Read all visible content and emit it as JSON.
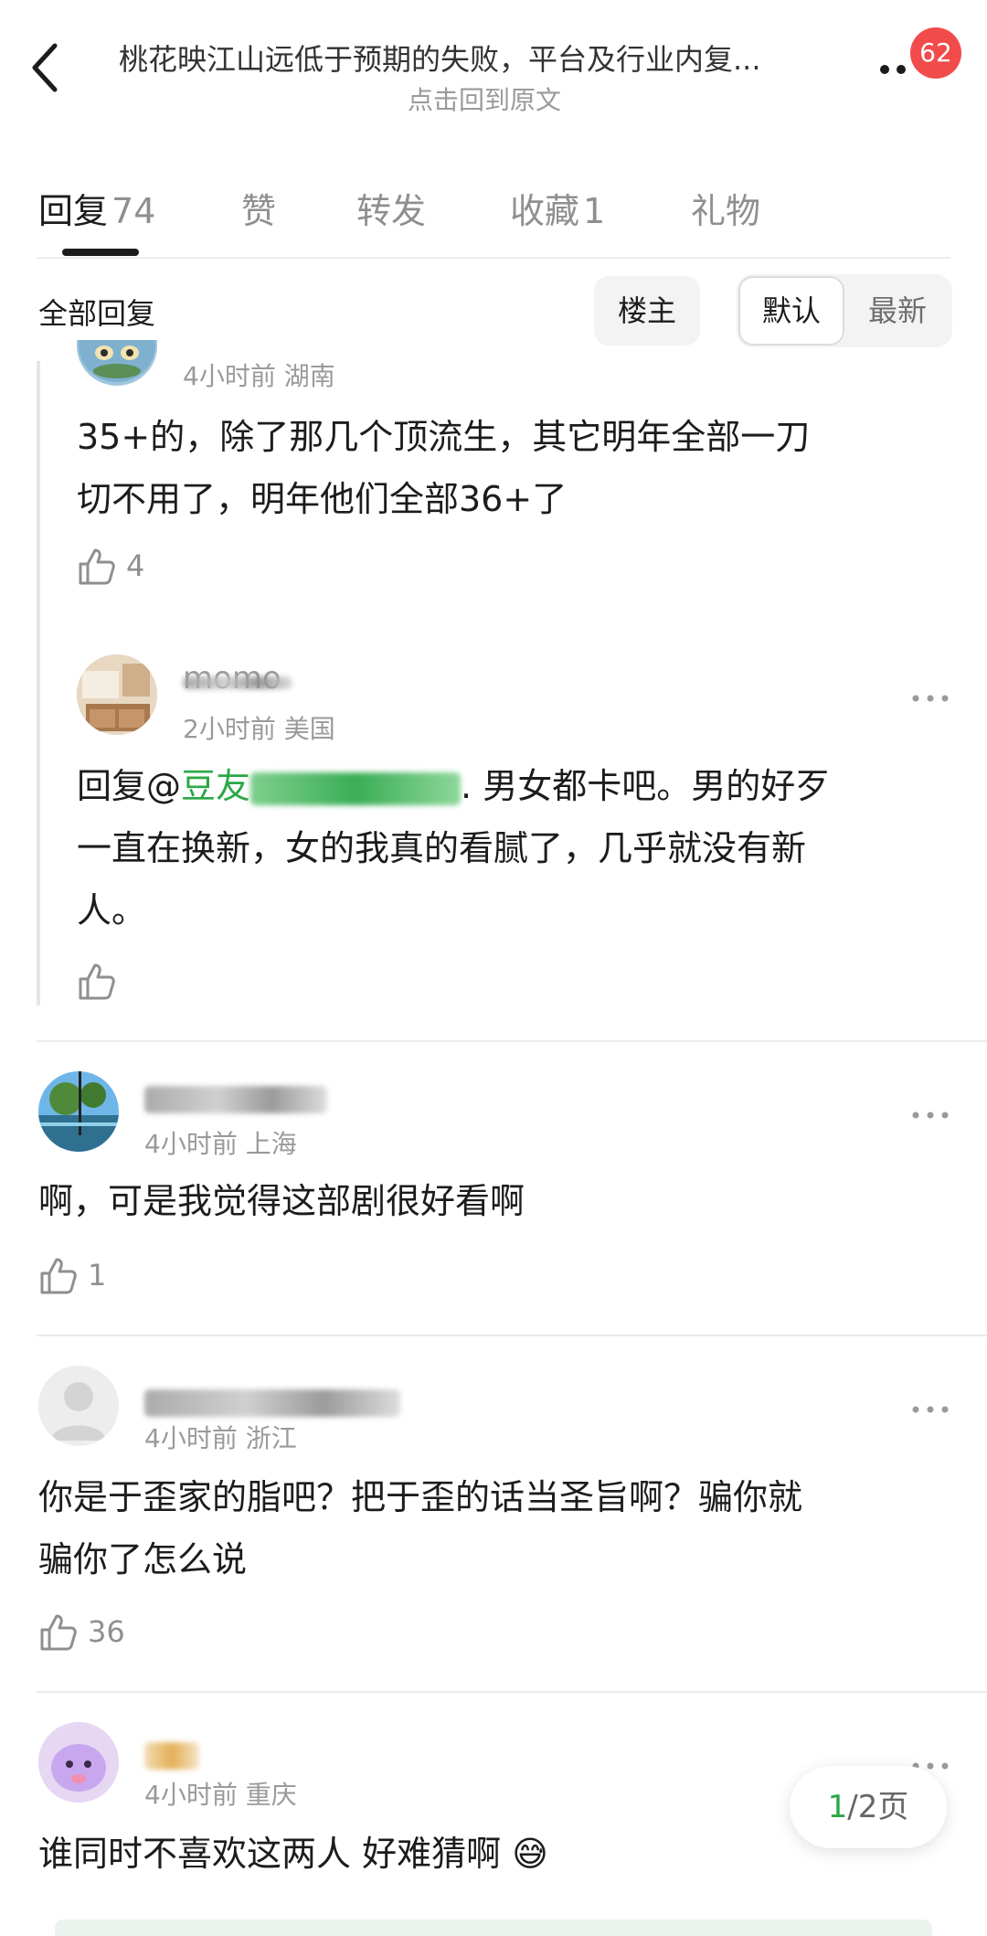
{
  "header": {
    "title": "桃花映江山远低于预期的失败，平台及行业内复...",
    "subtitle": "点击回到原文",
    "badge": "62"
  },
  "tabs": [
    {
      "label": "回复",
      "count": "74"
    },
    {
      "label": "赞",
      "count": ""
    },
    {
      "label": "转发",
      "count": ""
    },
    {
      "label": "收藏",
      "count": "1"
    },
    {
      "label": "礼物",
      "count": ""
    }
  ],
  "filter": {
    "label": "全部回复",
    "louzhu": "楼主",
    "sort_default": "默认",
    "sort_new": "最新"
  },
  "nested_replies": [
    {
      "meta": "4小时前 湖南",
      "content_line1": "35+的，除了那几个顶流生，其它明年全部一刀",
      "content_line2": "切不用了，明年他们全部36+了",
      "likes": "4"
    },
    {
      "name": "momo",
      "meta": "2小时前 美国",
      "mention_prefix": "回复@",
      "mention_visible": "豆友",
      "content_line1_rest": ". 男女都卡吧。男的好歹",
      "content_line2": "一直在换新，女的我真的看腻了，几乎就没有新",
      "content_line3": "人。",
      "likes": ""
    }
  ],
  "comments": [
    {
      "meta": "4小时前 上海",
      "content_line1": "啊，可是我觉得这部剧很好看啊",
      "likes": "1",
      "avatar_colors": {
        "sky": "#6fb6e8",
        "tree": "#4f8a3a",
        "water": "#2f6f8f"
      }
    },
    {
      "meta": "4小时前 浙江",
      "content_line1": "你是于歪家的脂吧？把于歪的话当圣旨啊？骗你就",
      "content_line2": "骗你了怎么说",
      "likes": "36"
    },
    {
      "meta": "4小时前 重庆",
      "content_line1": "谁同时不喜欢这两人 好难猜啊",
      "emoji": "😅"
    }
  ],
  "pagination": {
    "current": "1",
    "rest": "/2页"
  },
  "colors": {
    "accent_green": "#2aa845",
    "badge_red": "#f24b4b"
  }
}
